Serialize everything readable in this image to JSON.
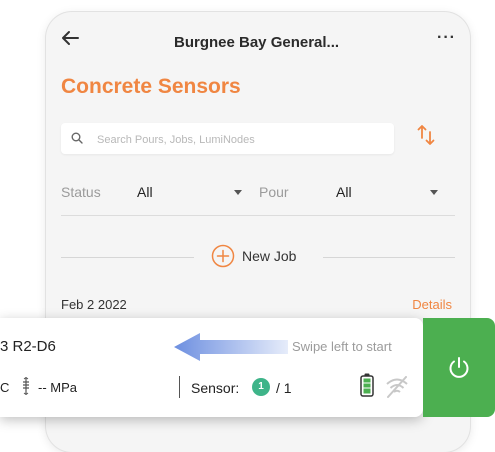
{
  "header": {
    "title": "Burgnee Bay General...",
    "more_icon": "more-horizontal-icon",
    "back_icon": "arrow-left-icon"
  },
  "page": {
    "heading": "Concrete Sensors"
  },
  "search": {
    "placeholder": "Search Pours, Jobs, LumiNodes",
    "value": ""
  },
  "filters": {
    "status": {
      "label": "Status",
      "value": "All"
    },
    "pour": {
      "label": "Pour",
      "value": "All"
    }
  },
  "new_job": {
    "label": "New Job"
  },
  "job": {
    "date": "Feb 2 2022",
    "details_label": "Details"
  },
  "card": {
    "name": "3 R2-D6",
    "swipe_hint": "Swipe left to start",
    "temp_unit": "C",
    "strength": "-- MPa",
    "sensor_label": "Sensor:",
    "sensor_count": "1",
    "sensor_total": "/ 1"
  },
  "colors": {
    "accent": "#f08642",
    "start_green": "#4caf50",
    "badge_green": "#3eb489"
  }
}
